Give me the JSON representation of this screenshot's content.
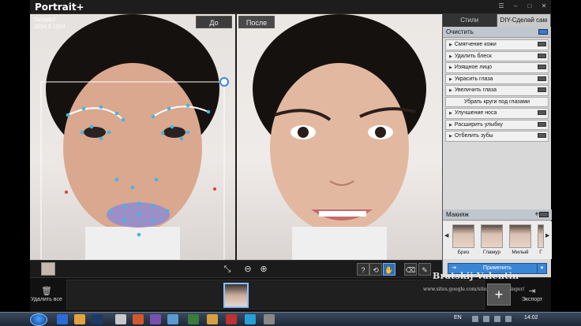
{
  "app": {
    "title": "Portrait+",
    "window_controls": [
      "menu-icon",
      "minimize-icon",
      "maximize-icon",
      "close-icon"
    ]
  },
  "image_info": {
    "name": "Sample2",
    "size": "1024 X 1024"
  },
  "view_toggle": {
    "before": "До",
    "after": "После"
  },
  "panel": {
    "tabs": [
      {
        "label": "Стили",
        "active": false
      },
      {
        "label": "DIY-Сделай сам",
        "active": true
      }
    ],
    "clean_section": {
      "title": "Очистить",
      "items": [
        {
          "label": "Смягчение кожи",
          "expandable": true
        },
        {
          "label": "Удалить блеск",
          "expandable": true
        },
        {
          "label": "Изящное лицо",
          "expandable": true
        },
        {
          "label": "Украсить глаза",
          "expandable": true
        },
        {
          "label": "Увеличить глаза",
          "expandable": true
        },
        {
          "label": "Убрать круги под глазами",
          "expandable": false
        },
        {
          "label": "Улучшение носа",
          "expandable": true
        },
        {
          "label": "Расширить улыбку",
          "expandable": true
        },
        {
          "label": "Отбелить зубы",
          "expandable": true
        }
      ]
    },
    "makeup": {
      "title": "Макияж",
      "presets": [
        "Бриз",
        "Гламур",
        "Милый",
        "Г"
      ]
    },
    "apply_label": "Применить"
  },
  "filmstrip": {
    "delete_all": "Удалить все",
    "export": "Экспорт"
  },
  "watermark": {
    "name": "Bratskij Valentin",
    "url": "www.sites.google.com/site/photodesinger/"
  },
  "taskbar": {
    "language": "EN",
    "time": "14:02"
  },
  "colors": {
    "accent": "#3a86d6",
    "landmark_dot": "#3fb8e0",
    "panel_bg": "#d8d8d8",
    "app_bg": "#1d1d1d"
  }
}
